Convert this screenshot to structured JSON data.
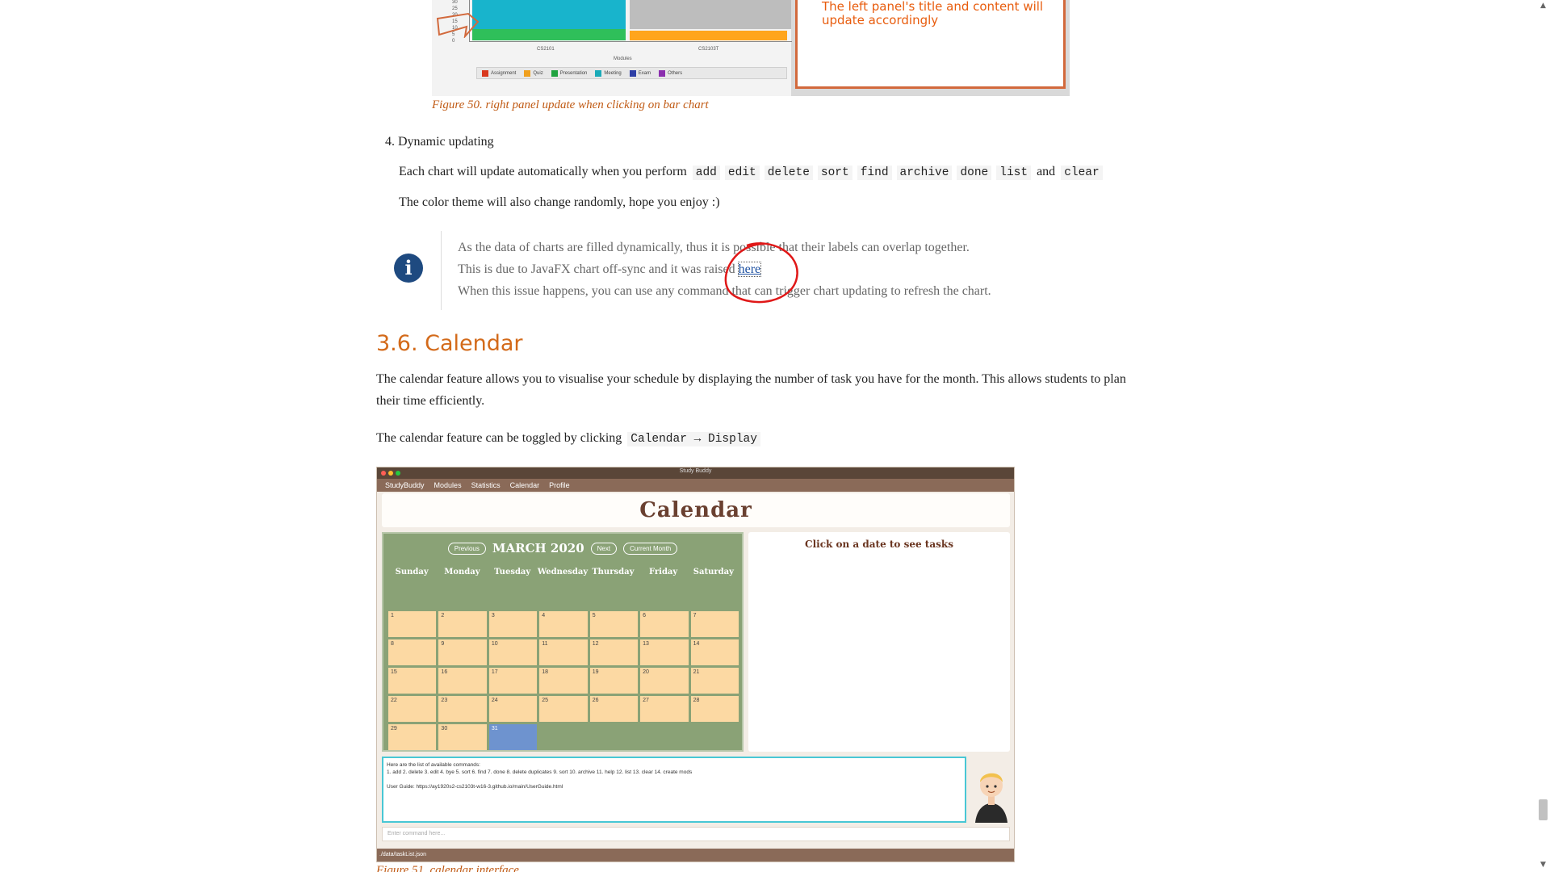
{
  "figure50": {
    "panel_text_line1": "The left panel's title and content will",
    "panel_text_line2": "update accordingly",
    "y_ticks": [
      "30",
      "25",
      "20",
      "15",
      "10",
      "5",
      "0"
    ],
    "categories": [
      "CS2101",
      "CS2103T"
    ],
    "x_label": "Modules",
    "legend": [
      {
        "label": "Assignment",
        "color": "#d9381e"
      },
      {
        "label": "Quiz",
        "color": "#f0a01e"
      },
      {
        "label": "Presentation",
        "color": "#21a340"
      },
      {
        "label": "Meeting",
        "color": "#1aaab8"
      },
      {
        "label": "Exam",
        "color": "#2e3fa6"
      },
      {
        "label": "Others",
        "color": "#8b2fae"
      }
    ],
    "caption": "Figure 50. right panel update when clicking on bar chart"
  },
  "list_item": {
    "number": "4.",
    "title": "Dynamic updating",
    "line1_prefix": "Each chart will update automatically when you perform",
    "commands": [
      "add",
      "edit",
      "delete",
      "sort",
      "find",
      "archive",
      "done",
      "list"
    ],
    "and_word": "and",
    "last_command": "clear",
    "line2": "The color theme will also change randomly, hope you enjoy :)"
  },
  "note": {
    "icon": "info-icon",
    "line1": "As the data of charts are filled dynamically, thus it is possible that their labels can overlap together.",
    "line2_prefix": "This is due to JavaFX chart off-sync and it was raised",
    "line2_link": "here",
    "line3": "When this issue happens, you can use any command that can trigger chart updating to refresh the chart."
  },
  "section": {
    "heading": "3.6. Calendar",
    "para1_line1": "The calendar feature allows you to visualise your schedule by displaying the number of task you have for the month. This allows students to plan",
    "para1_line2": "their time efficiently.",
    "para2_prefix": "The calendar feature can be toggled by clicking",
    "para2_code": "Calendar → Display"
  },
  "app": {
    "window_title": "Study Buddy",
    "menu": [
      "StudyBuddy",
      "Modules",
      "Statistics",
      "Calendar",
      "Profile"
    ],
    "header": "Calendar",
    "nav": {
      "previous": "Previous",
      "month": "MARCH 2020",
      "next": "Next",
      "current": "Current Month"
    },
    "weekdays": [
      "Sunday",
      "Monday",
      "Tuesday",
      "Wednesday",
      "Thursday",
      "Friday",
      "Saturday"
    ],
    "days": [
      "1",
      "2",
      "3",
      "4",
      "5",
      "6",
      "7",
      "8",
      "9",
      "10",
      "11",
      "12",
      "13",
      "14",
      "15",
      "16",
      "17",
      "18",
      "19",
      "20",
      "21",
      "22",
      "23",
      "24",
      "25",
      "26",
      "27",
      "28",
      "29",
      "30",
      "31"
    ],
    "selected_day": "31",
    "right_panel_title": "Click on a date to see tasks",
    "result_line1": "Here are the list of available commands:",
    "result_line2": "1. add  2. delete  3. edit  4. bye  5. sort  6. find  7. done  8. delete duplicates  9. sort  10. archive  11. help  12. list  13. clear 14. create mods",
    "result_line3": "User Guide: https://ay1920s2-cs2103t-w16-3.github.io/main/UserGuide.html",
    "command_placeholder": "Enter command here...",
    "status": "./data/taskList.json"
  },
  "figure51_caption": "Figure 51. calendar interface"
}
